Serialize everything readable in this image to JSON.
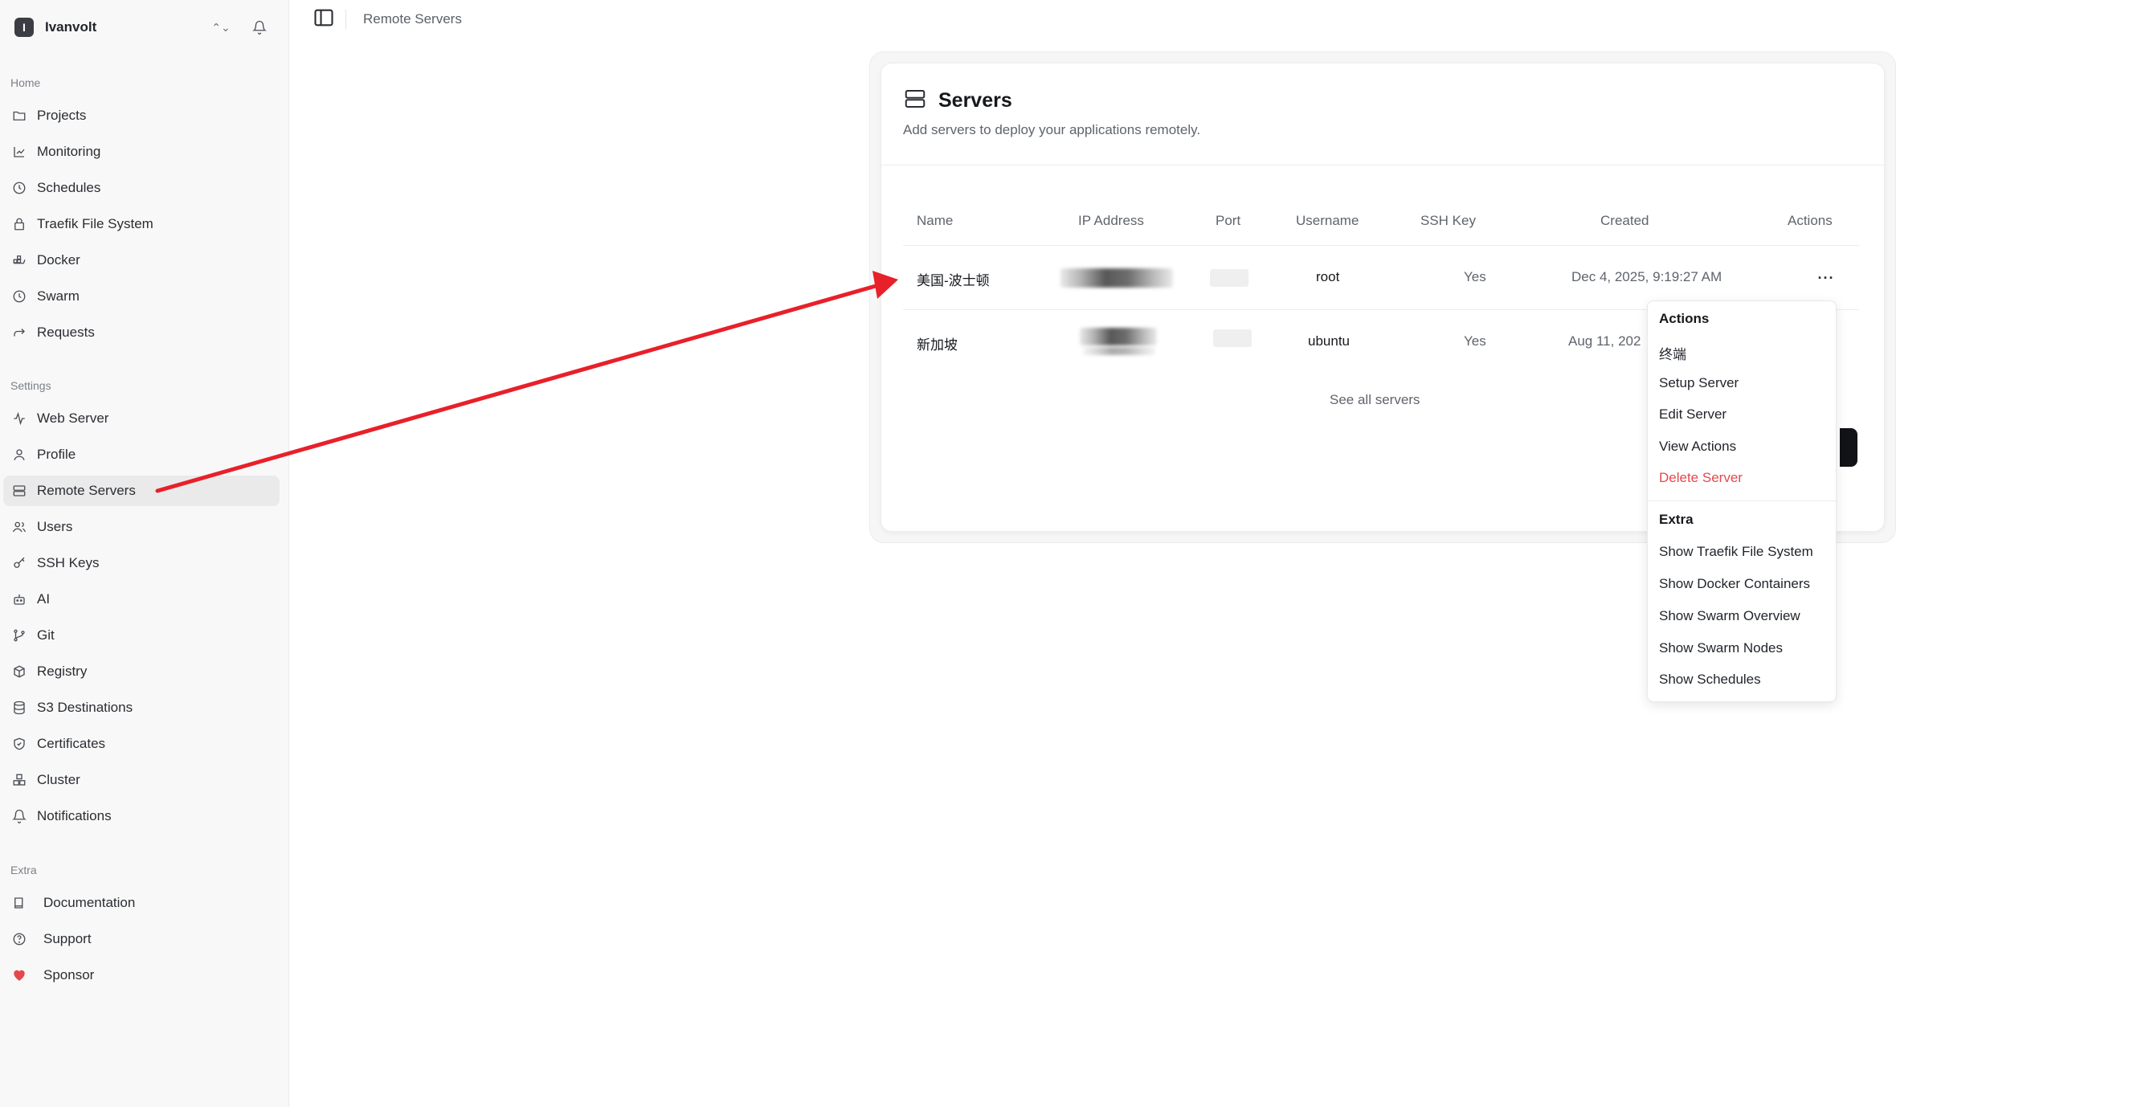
{
  "workspace": {
    "logo_letter": "I",
    "name": "Ivanvolt",
    "switch_glyph": "⌃⌄"
  },
  "sidebar": {
    "home_label": "Home",
    "home_items": [
      {
        "label": "Projects",
        "icon": "folder-icon"
      },
      {
        "label": "Monitoring",
        "icon": "chart-icon"
      },
      {
        "label": "Schedules",
        "icon": "clock-icon"
      },
      {
        "label": "Traefik File System",
        "icon": "file-lock-icon"
      },
      {
        "label": "Docker",
        "icon": "docker-icon"
      },
      {
        "label": "Swarm",
        "icon": "swarm-icon"
      },
      {
        "label": "Requests",
        "icon": "forward-icon"
      }
    ],
    "settings_label": "Settings",
    "settings_items": [
      {
        "label": "Web Server",
        "icon": "activity-icon"
      },
      {
        "label": "Profile",
        "icon": "user-icon"
      },
      {
        "label": "Remote Servers",
        "icon": "server-icon",
        "active": true
      },
      {
        "label": "Users",
        "icon": "users-icon"
      },
      {
        "label": "SSH Keys",
        "icon": "key-icon"
      },
      {
        "label": "AI",
        "icon": "bot-icon"
      },
      {
        "label": "Git",
        "icon": "git-branch-icon"
      },
      {
        "label": "Registry",
        "icon": "package-icon"
      },
      {
        "label": "S3 Destinations",
        "icon": "database-icon"
      },
      {
        "label": "Certificates",
        "icon": "shield-icon"
      },
      {
        "label": "Cluster",
        "icon": "boxes-icon"
      },
      {
        "label": "Notifications",
        "icon": "bell-icon"
      }
    ],
    "extra_label": "Extra",
    "extra_items": [
      {
        "label": "Documentation",
        "icon": "book-icon"
      },
      {
        "label": "Support",
        "icon": "help-circle-icon"
      },
      {
        "label": "Sponsor",
        "icon": "heart-icon"
      }
    ]
  },
  "topbar": {
    "breadcrumb": "Remote Servers"
  },
  "card": {
    "title": "Servers",
    "subtitle": "Add servers to deploy your applications remotely.",
    "columns": [
      "Name",
      "IP Address",
      "Port",
      "Username",
      "SSH Key",
      "Created",
      "Actions"
    ],
    "rows": [
      {
        "name": "美国-波士顿",
        "username": "root",
        "ssh_key": "Yes",
        "created": "Dec 4, 2025, 9:19:27 AM"
      },
      {
        "name": "新加坡",
        "username": "ubuntu",
        "ssh_key": "Yes",
        "created": "Aug 11, 202"
      }
    ],
    "see_all": "See all servers",
    "actions_glyph": "···"
  },
  "menu": {
    "actions_heading": "Actions",
    "actions": [
      "终端",
      "Setup Server",
      "Edit Server",
      "View Actions"
    ],
    "delete": "Delete Server",
    "extra_heading": "Extra",
    "extra": [
      "Show Traefik File System",
      "Show Docker Containers",
      "Show Swarm Overview",
      "Show Swarm Nodes",
      "Show Schedules"
    ]
  },
  "colors": {
    "annotation_arrow": "#e8202a",
    "danger": "#e5484d",
    "active_bg": "#eaeaea"
  }
}
